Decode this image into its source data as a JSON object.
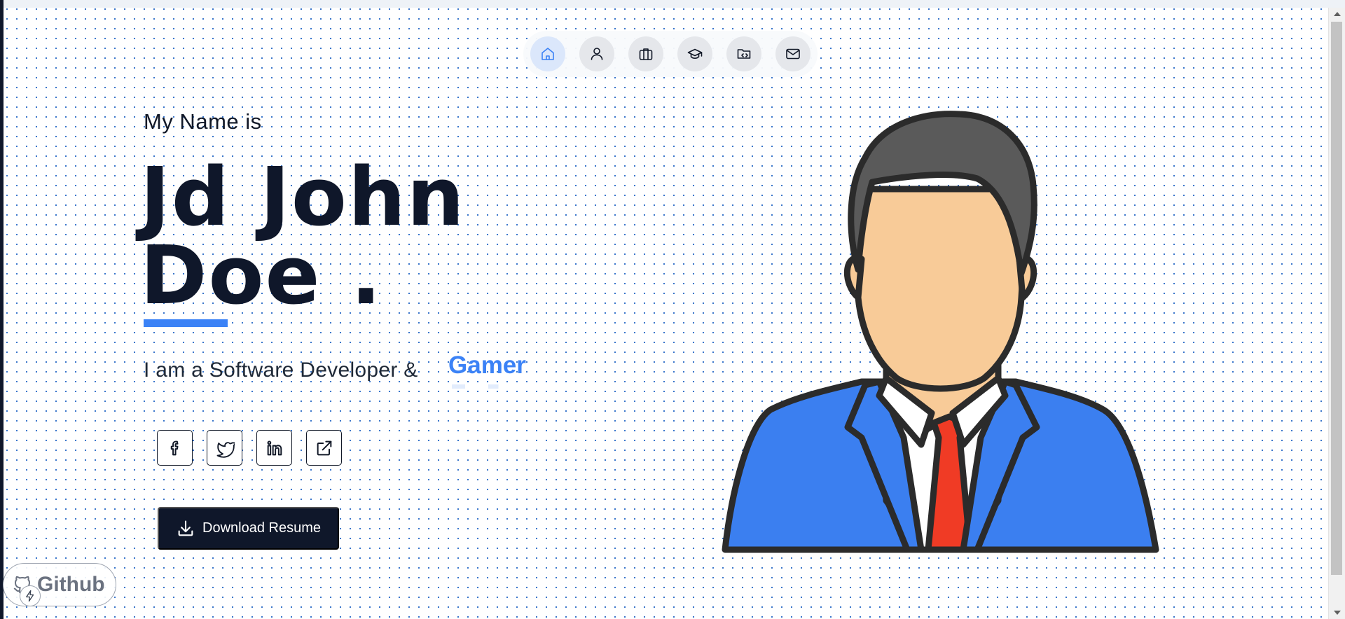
{
  "nav": {
    "items": [
      {
        "icon": "home-icon",
        "active": true
      },
      {
        "icon": "user-icon",
        "active": false
      },
      {
        "icon": "briefcase-icon",
        "active": false
      },
      {
        "icon": "graduation-cap-icon",
        "active": false
      },
      {
        "icon": "folder-code-icon",
        "active": false
      },
      {
        "icon": "mail-icon",
        "active": false
      }
    ]
  },
  "hero": {
    "intro": "My Name is",
    "name_line_1": "Jd John",
    "name_line_2": "Doe .",
    "tagline": "I am a Software Developer &",
    "typed_word": "Gamer"
  },
  "socials": [
    {
      "icon": "facebook-icon"
    },
    {
      "icon": "twitter-icon"
    },
    {
      "icon": "linkedin-icon"
    },
    {
      "icon": "external-link-icon"
    }
  ],
  "download": {
    "label": "Download Resume",
    "icon": "download-icon"
  },
  "github": {
    "label": "Github",
    "icon": "github-icon",
    "badge_icon": "bolt-icon"
  },
  "colors": {
    "accent": "#3b82f6",
    "dark": "#0f172a",
    "dots": "#2f6fc8",
    "suit": "#3b7ff0",
    "tie": "#f03b25",
    "skin": "#f8cb98",
    "hair": "#5a5a5a"
  }
}
